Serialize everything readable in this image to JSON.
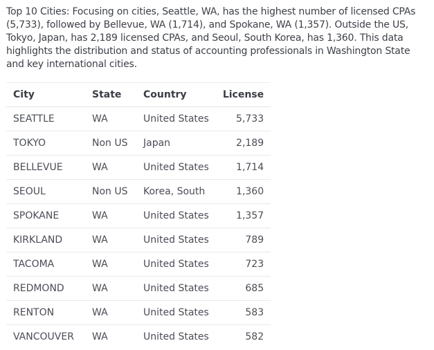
{
  "summary": "Top 10 Cities: Focusing on cities, Seattle, WA, has the highest number of licensed CPAs (5,733), followed by Bellevue, WA (1,714), and Spokane, WA (1,357). Outside the US, Tokyo, Japan, has 2,189 licensed CPAs, and Seoul, South Korea, has 1,360. This data highlights the distribution and status of accounting professionals in Washington State and key international cities.",
  "table": {
    "headers": {
      "city": "City",
      "state": "State",
      "country": "Country",
      "license": "License"
    },
    "rows": [
      {
        "city": "SEATTLE",
        "state": "WA",
        "country": "United States",
        "license": "5,733"
      },
      {
        "city": "TOKYO",
        "state": "Non US",
        "country": "Japan",
        "license": "2,189"
      },
      {
        "city": "BELLEVUE",
        "state": "WA",
        "country": "United States",
        "license": "1,714"
      },
      {
        "city": "SEOUL",
        "state": "Non US",
        "country": "Korea, South",
        "license": "1,360"
      },
      {
        "city": "SPOKANE",
        "state": "WA",
        "country": "United States",
        "license": "1,357"
      },
      {
        "city": "KIRKLAND",
        "state": "WA",
        "country": "United States",
        "license": "789"
      },
      {
        "city": "TACOMA",
        "state": "WA",
        "country": "United States",
        "license": "723"
      },
      {
        "city": "REDMOND",
        "state": "WA",
        "country": "United States",
        "license": "685"
      },
      {
        "city": "RENTON",
        "state": "WA",
        "country": "United States",
        "license": "583"
      },
      {
        "city": "VANCOUVER",
        "state": "WA",
        "country": "United States",
        "license": "582"
      }
    ]
  }
}
